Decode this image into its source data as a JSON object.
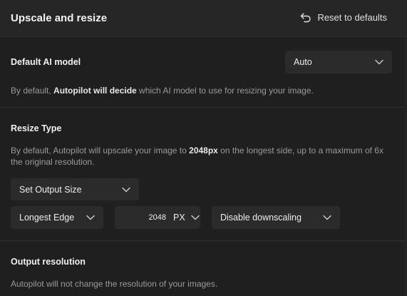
{
  "header": {
    "title": "Upscale and resize",
    "reset_label": "Reset to defaults"
  },
  "ai_model": {
    "label": "Default AI model",
    "selected": "Auto",
    "desc_prefix": "By default, ",
    "desc_bold": "Autopilot will decide",
    "desc_suffix": " which AI model to use for resizing your image."
  },
  "resize_type": {
    "label": "Resize Type",
    "desc_prefix": "By default, Autopilot will upscale your image to ",
    "desc_bold": "2048px",
    "desc_suffix": " on the longest side, up to a maximum of 6x the original resolution.",
    "output_mode": "Set Output Size",
    "edge": "Longest Edge",
    "size_value": "2048",
    "unit": "PX",
    "downscaling": "Disable downscaling"
  },
  "output_resolution": {
    "label": "Output resolution",
    "desc": "Autopilot will not change the resolution of your images."
  }
}
